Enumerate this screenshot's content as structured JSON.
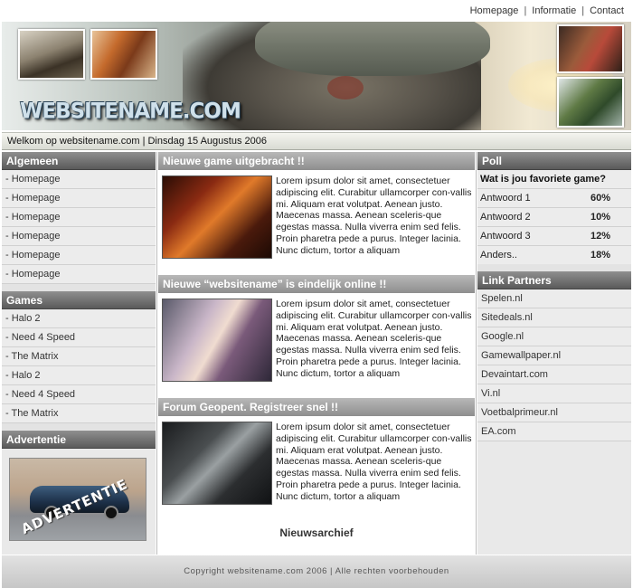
{
  "top_nav": {
    "links": [
      "Homepage",
      "Informatie",
      "Contact"
    ],
    "separator": "|"
  },
  "header": {
    "logo_text": "WEBSITENAME.COM"
  },
  "welcome": {
    "text": "Welkom op websitename.com | Dinsdag 15 Augustus 2006"
  },
  "left": {
    "algemeen": {
      "title": "Algemeen",
      "items": [
        "- Homepage",
        "- Homepage",
        "- Homepage",
        "- Homepage",
        "- Homepage",
        "- Homepage"
      ]
    },
    "games": {
      "title": "Games",
      "items": [
        "- Halo 2",
        "- Need 4 Speed",
        "- The Matrix",
        "- Halo 2",
        "- Need 4 Speed",
        "- The Matrix"
      ]
    },
    "advertentie": {
      "title": "Advertentie",
      "banner_text": "ADVERTENTIE"
    }
  },
  "news": [
    {
      "title": "Nieuwe game uitgebracht !!",
      "body": "Lorem ipsum dolor sit amet, consectetuer adipiscing elit. Curabitur ullamcorper con-vallis mi. Aliquam erat volutpat. Aenean justo. Maecenas massa. Aenean sceleris-que egestas massa. Nulla viverra enim sed felis. Proin pharetra pede a purus. Integer lacinia. Nunc dictum, tortor a aliquam"
    },
    {
      "title": "Nieuwe “websitename” is eindelijk online !!",
      "body": "Lorem ipsum dolor sit amet, consectetuer adipiscing elit. Curabitur ullamcorper con-vallis mi. Aliquam erat volutpat. Aenean justo. Maecenas massa. Aenean sceleris-que egestas massa. Nulla viverra enim sed felis. Proin pharetra pede a purus. Integer lacinia. Nunc dictum, tortor a aliquam"
    },
    {
      "title": "Forum Geopent. Registreer snel !!",
      "body": "Lorem ipsum dolor sit amet, consectetuer adipiscing elit. Curabitur ullamcorper con-vallis mi. Aliquam erat volutpat. Aenean justo. Maecenas massa. Aenean sceleris-que egestas massa. Nulla viverra enim sed felis. Proin pharetra pede a purus. Integer lacinia. Nunc dictum, tortor a aliquam"
    }
  ],
  "archive_link": "Nieuwsarchief",
  "right": {
    "poll": {
      "title": "Poll",
      "question": "Wat is jou favoriete game?",
      "options": [
        {
          "label": "Antwoord 1",
          "pct": "60%"
        },
        {
          "label": "Antwoord 2",
          "pct": "10%"
        },
        {
          "label": "Antwoord 3",
          "pct": "12%"
        },
        {
          "label": "Anders..",
          "pct": "18%"
        }
      ]
    },
    "partners": {
      "title": "Link Partners",
      "items": [
        "Spelen.nl",
        "Sitedeals.nl",
        "Google.nl",
        "Gamewallpaper.nl",
        "Devaintart.com",
        "Vi.nl",
        "Voetbalprimeur.nl",
        "EA.com"
      ]
    }
  },
  "footer": {
    "text": "Copyright websitename.com 2006 | Alle rechten voorbehouden"
  }
}
